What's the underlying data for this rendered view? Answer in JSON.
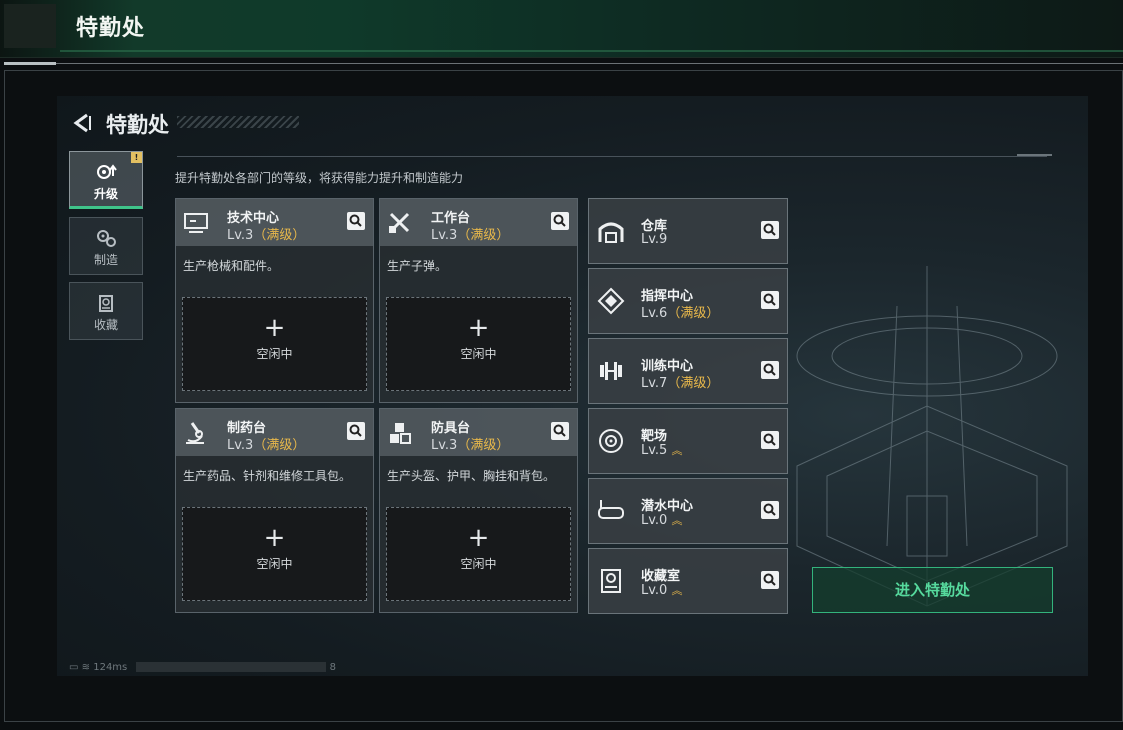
{
  "window": {
    "title": "特勤处"
  },
  "game": {
    "title": "特勤处",
    "description": "提升特勤处各部门的等级，将获得能力提升和制造能力",
    "tabs": [
      {
        "label": "升级",
        "icon": "upgrade-gear-icon",
        "active": true,
        "badge": "!"
      },
      {
        "label": "制造",
        "icon": "gears-icon",
        "active": false
      },
      {
        "label": "收藏",
        "icon": "collection-icon",
        "active": false
      }
    ],
    "workshops": [
      {
        "name": "技术中心",
        "level": "Lv.3",
        "max": "（满级）",
        "desc": "生产枪械和配件。",
        "slot": "空闲中",
        "icon": "computer-icon"
      },
      {
        "name": "工作台",
        "level": "Lv.3",
        "max": "（满级）",
        "desc": "生产子弹。",
        "slot": "空闲中",
        "icon": "tools-icon"
      },
      {
        "name": "制药台",
        "level": "Lv.3",
        "max": "（满级）",
        "desc": "生产药品、针剂和维修工具包。",
        "slot": "空闲中",
        "icon": "microscope-icon"
      },
      {
        "name": "防具台",
        "level": "Lv.3",
        "max": "（满级）",
        "desc": "生产头盔、护甲、胸挂和背包。",
        "slot": "空闲中",
        "icon": "armor-cubes-icon"
      }
    ],
    "facilities": [
      {
        "name": "仓库",
        "level": "Lv.9",
        "max": "",
        "icon": "warehouse-icon"
      },
      {
        "name": "指挥中心",
        "level": "Lv.6",
        "max": "（满级）",
        "icon": "command-icon"
      },
      {
        "name": "训练中心",
        "level": "Lv.7",
        "max": "（满级）",
        "icon": "dumbbell-icon"
      },
      {
        "name": "靶场",
        "level": "Lv.5",
        "max": "",
        "icon": "target-icon",
        "upgradable": true
      },
      {
        "name": "潜水中心",
        "level": "Lv.0",
        "max": "",
        "icon": "diving-mask-icon",
        "upgradable": true
      },
      {
        "name": "收藏室",
        "level": "Lv.0",
        "max": "",
        "icon": "collection-room-icon",
        "upgradable": true
      }
    ],
    "enter_button": "进入特勤处",
    "status": {
      "ping": "124ms",
      "digit": "8"
    },
    "colors": {
      "accent": "#3fc48a",
      "max_level": "#e9b94b",
      "badge": "#e3c062"
    }
  }
}
